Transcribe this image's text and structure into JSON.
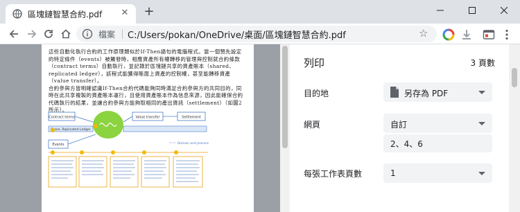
{
  "tab": {
    "title": "區塊鏈智慧合約.pdf"
  },
  "omnibox": {
    "label": "檔案",
    "url": "C:/Users/pokan/OneDrive/桌面/區塊鏈智慧合約.pdf"
  },
  "pdf": {
    "paragraphs": [
      "這些自動化執行合約的工作原理類似於If-Then語句的電腦程式。當一個預先設定的特定條件（events）被觸發時，相應資產所有權轉移的管理與控制就合約條款（contract terms）自動執行，並記錄於區塊鏈共享的資產賬本（shared、replicated ledger），該程式能獲得賬面上資產的控制權，甚至能轉移資產（value transfer）。",
      "合約參與方皆明確認識If-Then合約代碼能夠同時滿足合約參與方的共同目的，同時在此共享複製的資產賬本運行，且使用資產賬本作為信息來源，因此能確保合約代碼執行的結果，並讓合約參與方能夠取相同的產出資訊（settlement）（如圖2所示）。"
    ],
    "diagram": {
      "top_labels": [
        "Contract terms",
        "Value transfer",
        "Settlement"
      ],
      "ledger_label": "Share, Replicated Ledger",
      "events_label": "Events",
      "legend_label": "Domain and process"
    }
  },
  "print": {
    "title": "列印",
    "sheet_count": "3 頁數",
    "destination": {
      "label": "目的地",
      "value": "另存為 PDF"
    },
    "pages": {
      "label": "網頁",
      "value": "自訂",
      "input_value": "2、4、6"
    },
    "pages_per_sheet": {
      "label": "每張工作表頁數",
      "value": "1"
    }
  }
}
